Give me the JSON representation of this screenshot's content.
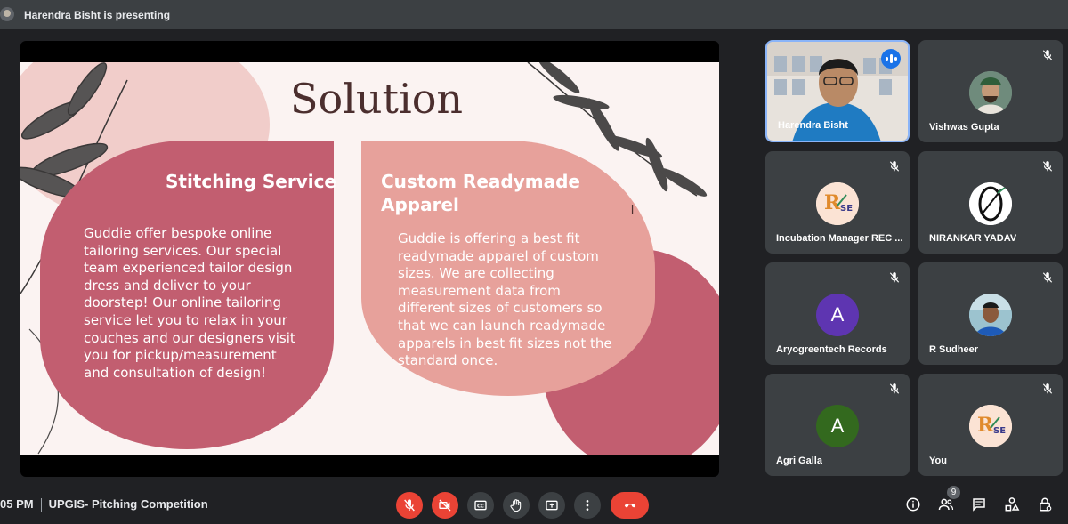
{
  "presenter_bar": {
    "text": "Harendra Bisht is presenting"
  },
  "slide": {
    "title": "Solution",
    "card_left": {
      "title": "Stitching Service",
      "body_lines": [
        "Guddie offer bespoke online",
        "tailoring services. Our special",
        "team experienced tailor design",
        "dress and deliver to your",
        "doorstep! Our online tailoring",
        "service let you to relax in your",
        "couches and our designers visit",
        "you for pickup/measurement",
        "and consultation of design!"
      ]
    },
    "card_right": {
      "title_lines": [
        "Custom Readymade",
        "Apparel"
      ],
      "body_lines": [
        "Guddie is offering a best fit",
        "readymade apparel of custom",
        "sizes. We are collecting",
        "measurement data from",
        "different sizes of customers so",
        "that we can launch readymade",
        "apparels in best fit sizes not the",
        "standard once."
      ]
    },
    "stray_text": "l",
    "colors": {
      "background": "#fbf3f2",
      "card_left": "#c25e70",
      "card_right": "#e7a19b",
      "blob": "#c25e70",
      "title": "#4b2e2e"
    }
  },
  "participants": [
    {
      "name": "Harendra Bisht",
      "speaking": true,
      "avatar": "video"
    },
    {
      "name": "Vishwas Gupta",
      "muted": true,
      "avatar": "photo"
    },
    {
      "name": "Incubation Manager REC ...",
      "muted": true,
      "avatar": "logo"
    },
    {
      "name": "NIRANKAR YADAV",
      "muted": true,
      "avatar": "logo-0"
    },
    {
      "name": "Aryogreentech Records",
      "muted": true,
      "avatar": "A",
      "avatar_color": "#5e35b1"
    },
    {
      "name": "R Sudheer",
      "muted": true,
      "avatar": "photo"
    },
    {
      "name": "Agri Galla",
      "muted": true,
      "avatar": "A",
      "avatar_color": "#33691e"
    },
    {
      "name": "You",
      "muted": true,
      "avatar": "logo"
    }
  ],
  "bottom_bar": {
    "time": "05 PM",
    "meeting_name": "UPGIS- Pitching Competition",
    "controls": [
      "mic-off-icon",
      "camera-off-icon",
      "captions-icon",
      "raise-hand-icon",
      "present-icon",
      "more-icon",
      "end-call-icon"
    ],
    "people_count": "9",
    "right_icons": [
      "info-icon",
      "people-icon",
      "chat-icon",
      "activities-icon",
      "host-controls-icon"
    ]
  }
}
